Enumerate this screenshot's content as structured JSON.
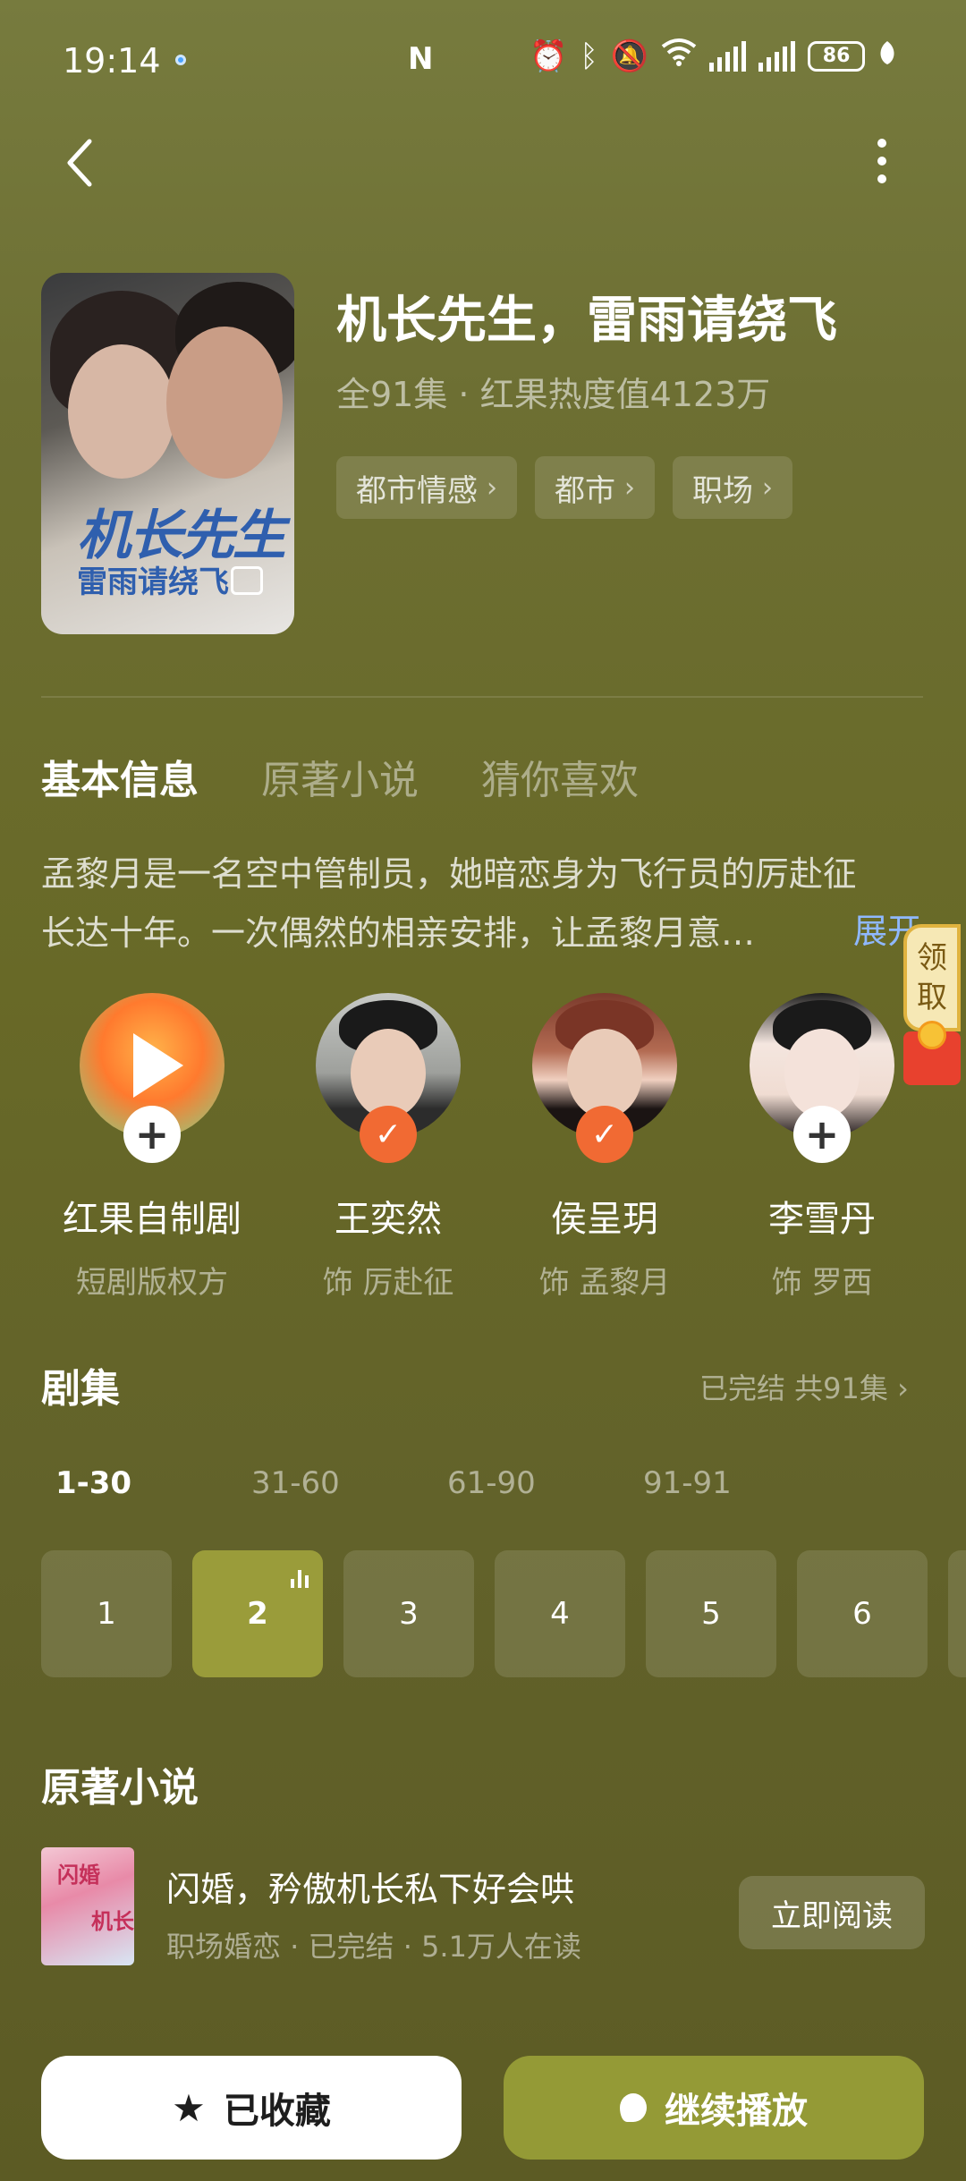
{
  "status_bar": {
    "time": "19:14",
    "battery": "86",
    "icons": [
      "nfc-icon",
      "alarm-icon",
      "bluetooth-icon",
      "mute-icon",
      "wifi-icon",
      "signal-icon",
      "signal-icon",
      "battery-icon",
      "leaf-icon"
    ]
  },
  "header": {
    "back_icon": "chevron-left-icon",
    "more_icon": "more-vertical-icon"
  },
  "drama": {
    "title": "机长先生，雷雨请绕飞",
    "meta": "全91集 · 红果热度值4123万",
    "poster_title_line1": "机长先生",
    "poster_title_line2": "雷雨请绕飞",
    "tags": [
      {
        "label": "都市情感"
      },
      {
        "label": "都市"
      },
      {
        "label": "职场"
      }
    ]
  },
  "info_tabs": [
    {
      "label": "基本信息",
      "active": true
    },
    {
      "label": "原著小说",
      "active": false
    },
    {
      "label": "猜你喜欢",
      "active": false
    }
  ],
  "synopsis": {
    "line1": "孟黎月是一名空中管制员，她暗恋身为飞行员的厉赴征",
    "line2": "长达十年。一次偶然的相亲安排，让孟黎月意…",
    "expand": "展开"
  },
  "reward": {
    "label_top": "领",
    "label_bottom": "取"
  },
  "cast": [
    {
      "name": "红果自制剧",
      "role": "短剧版权方",
      "badge": "add"
    },
    {
      "name": "王奕然",
      "role": "饰 厉赴征",
      "badge": "check"
    },
    {
      "name": "侯呈玥",
      "role": "饰 孟黎月",
      "badge": "check"
    },
    {
      "name": "李雪丹",
      "role": "饰 罗西",
      "badge": "add"
    }
  ],
  "episodes": {
    "heading": "剧集",
    "status": "已完结 共91集",
    "ranges": [
      {
        "label": "1-30",
        "active": true
      },
      {
        "label": "31-60",
        "active": false
      },
      {
        "label": "61-90",
        "active": false
      },
      {
        "label": "91-91",
        "active": false
      }
    ],
    "items": [
      "1",
      "2",
      "3",
      "4",
      "5",
      "6"
    ],
    "current": "2"
  },
  "novel": {
    "heading": "原著小说",
    "title": "闪婚，矜傲机长私下好会哄",
    "meta": "职场婚恋 · 已完结 · 5.1万人在读",
    "read_label": "立即阅读"
  },
  "actions": {
    "favorite_label": "已收藏",
    "play_label": "继续播放"
  },
  "colors": {
    "background": "#6a6a2c",
    "accent": "#949a36",
    "badge_check": "#f16a33",
    "link": "#8fb8ff"
  }
}
